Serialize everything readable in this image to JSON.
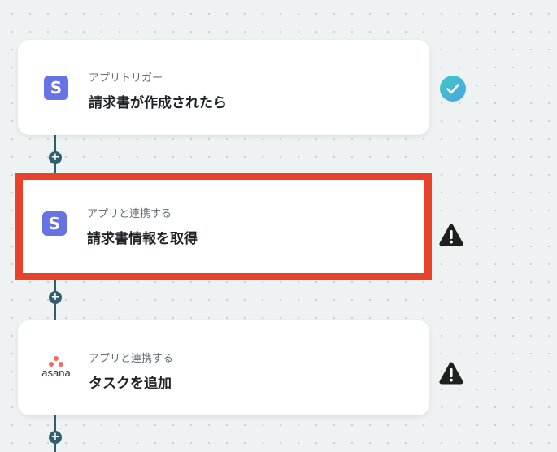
{
  "steps": [
    {
      "subtitle": "アプリトリガー",
      "title": "請求書が作成されたら",
      "app_icon": "stripe-icon",
      "app_letter": "S",
      "status_icon": "check-circle-icon",
      "status": "complete"
    },
    {
      "subtitle": "アプリと連携する",
      "title": "請求書情報を取得",
      "app_icon": "stripe-icon",
      "app_letter": "S",
      "status_icon": "warning-icon",
      "status": "warning",
      "highlighted": true
    },
    {
      "subtitle": "アプリと連携する",
      "title": "タスクを追加",
      "app_icon": "asana-logo",
      "app_name": "asana",
      "status_icon": "warning-icon",
      "status": "warning"
    }
  ],
  "add_step_symbol": "+",
  "colors": {
    "background": "#eef2f3",
    "connector": "#2f5f6f",
    "highlight_border": "#e8432a",
    "stripe_brand": "#6772e5",
    "asana_brand": "#f06a6a",
    "success_gradient_start": "#3ec9c3",
    "success_gradient_end": "#4aa3e6",
    "warning": "#1f1f1f"
  }
}
